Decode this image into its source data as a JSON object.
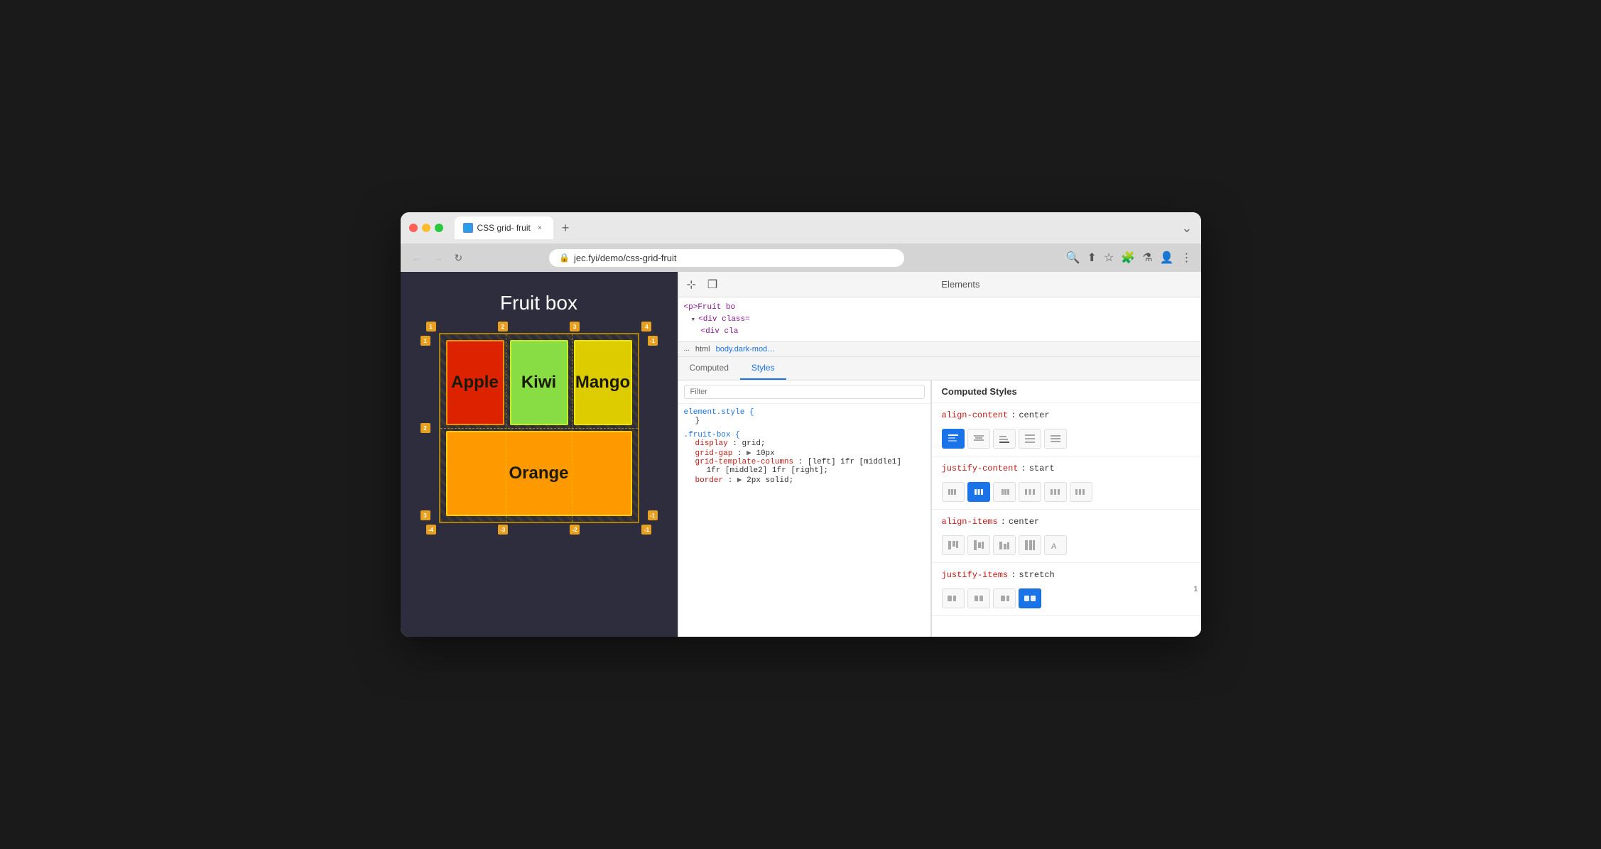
{
  "browser": {
    "tab_title": "CSS grid- fruit",
    "url": "jec.fyi/demo/css-grid-fruit",
    "tab_close_label": "×",
    "tab_new_label": "+",
    "window_chevron": "⌄",
    "nav_back": "←",
    "nav_forward": "→",
    "nav_refresh": "↻"
  },
  "webpage": {
    "title": "Fruit box",
    "fruits": [
      {
        "name": "Apple",
        "color": "#dd2200"
      },
      {
        "name": "Kiwi",
        "color": "#88dd44"
      },
      {
        "name": "Mango",
        "color": "#ddcc00"
      },
      {
        "name": "Orange",
        "color": "#ff9900"
      }
    ],
    "grid_labels_top": [
      "1",
      "2",
      "3",
      "4"
    ],
    "grid_labels_left": [
      "1",
      "2",
      "3"
    ],
    "grid_labels_bottom": [
      "-4",
      "-3",
      "-2",
      "-1"
    ],
    "grid_labels_right": [
      "-1"
    ]
  },
  "devtools": {
    "header_icon_cursor": "⊹",
    "header_icon_layers": "❐",
    "header_tab": "Elements",
    "html_lines": [
      "<p>Fruit bo",
      "<div class=",
      "<div clas"
    ],
    "ellipsis": "...",
    "breadcrumb": [
      "html",
      "body.dark-mod…"
    ],
    "tabs": [
      "Computed",
      "Styles"
    ],
    "active_tab": "Styles",
    "filter_placeholder": "Filter",
    "css_rules": [
      {
        "selector": "element.style {",
        "properties": []
      },
      {
        "selector": ".fruit-box {",
        "properties": [
          {
            "name": "display",
            "value": "grid;"
          },
          {
            "name": "grid-gap",
            "value": "▶ 10px"
          },
          {
            "name": "grid-template-columns",
            "value": "[left] 1fr [middle1]"
          },
          {
            "name": "",
            "value": "1fr [middle2] 1fr [right];"
          },
          {
            "name": "border",
            "value": "▶ 2px solid;"
          }
        ]
      }
    ]
  },
  "computed_styles": {
    "title": "Computed Styles",
    "sections": [
      {
        "property": "align-content",
        "value": "center",
        "buttons": [
          {
            "icon": "≡",
            "label": "start",
            "active": true
          },
          {
            "icon": "≡",
            "label": "center",
            "active": false
          },
          {
            "icon": "≡",
            "label": "end",
            "active": false
          },
          {
            "icon": "≡",
            "label": "space-between",
            "active": false
          },
          {
            "icon": "≡",
            "label": "space-around",
            "active": false
          }
        ]
      },
      {
        "property": "justify-content",
        "value": "start",
        "buttons": [
          {
            "icon": "⊞",
            "label": "start",
            "active": false
          },
          {
            "icon": "⊞",
            "label": "center",
            "active": true
          },
          {
            "icon": "⊞",
            "label": "end",
            "active": false
          },
          {
            "icon": "⊞",
            "label": "space-between",
            "active": false
          },
          {
            "icon": "⊞",
            "label": "space-around",
            "active": false
          },
          {
            "icon": "⊞",
            "label": "space-evenly",
            "active": false
          }
        ]
      },
      {
        "property": "align-items",
        "value": "center",
        "buttons": [
          {
            "icon": "⊞",
            "label": "start",
            "active": false
          },
          {
            "icon": "⊞",
            "label": "center",
            "active": false
          },
          {
            "icon": "⊞",
            "label": "end",
            "active": false
          },
          {
            "icon": "⊞",
            "label": "stretch",
            "active": false
          },
          {
            "icon": "A",
            "label": "baseline",
            "active": false
          }
        ]
      },
      {
        "property": "justify-items",
        "value": "stretch",
        "buttons": [
          {
            "icon": "⊞",
            "label": "start",
            "active": false
          },
          {
            "icon": "⊞",
            "label": "center",
            "active": false
          },
          {
            "icon": "⊞",
            "label": "end",
            "active": false
          },
          {
            "icon": "⊞",
            "label": "stretch",
            "active": true
          }
        ]
      }
    ],
    "scroll_indicator": "1"
  }
}
